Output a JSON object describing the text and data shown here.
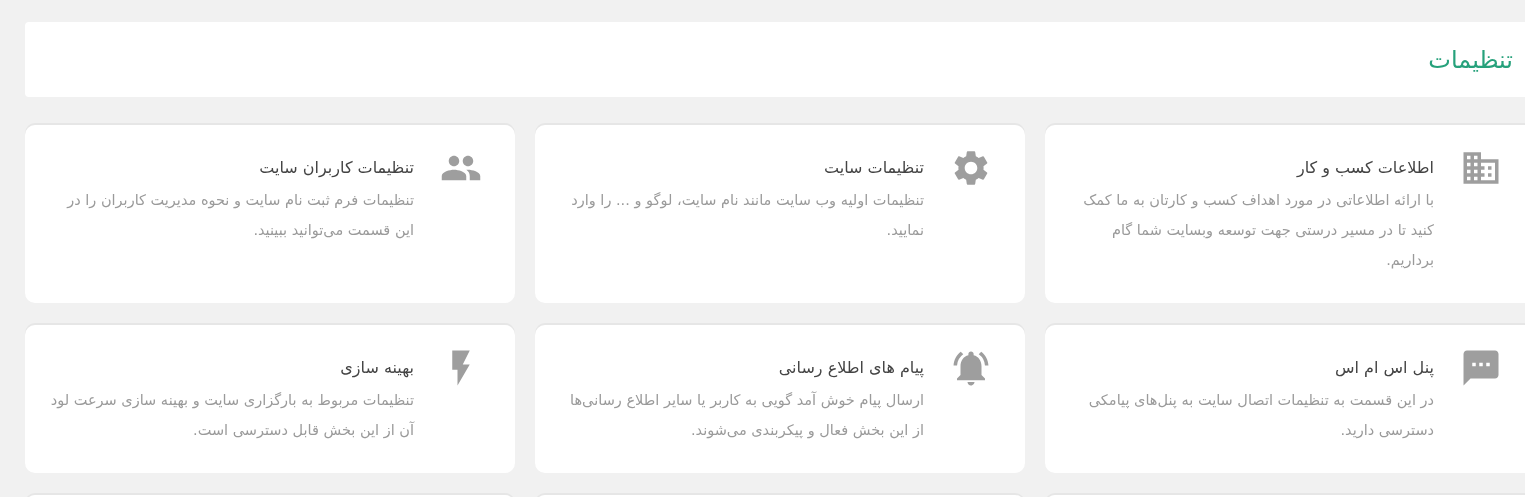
{
  "header": {
    "title": "تنظیمات"
  },
  "cards": [
    {
      "kind": "feature",
      "title": "اطلاعات کسب و کار",
      "description": "با ارائه اطلاعاتی در مورد اهداف کسب و کارتان به ما کمک کنید تا در مسیر درستی جهت توسعه وبسایت شما گام برداریم."
    },
    {
      "kind": "feature",
      "title": "تنظیمات سایت",
      "description": "تنظیمات اولیه وب سایت مانند نام سایت، لوگو و ... را وارد نمایید."
    },
    {
      "kind": "feature",
      "title": "تنظیمات کاربران سایت",
      "description": "تنظیمات فرم ثبت نام سایت و نحوه مدیریت کاربران را در این قسمت می‌توانید ببینید."
    },
    {
      "kind": "feature",
      "title": "پنل اس ام اس",
      "description": "در این قسمت به تنظیمات اتصال سایت به پنل‌های پیامکی دسترسی دارید."
    },
    {
      "kind": "feature",
      "title": "پیام های اطلاع رسانی",
      "description": "ارسال پیام خوش آمد گویی به کاربر یا سایر اطلاع رسانی‌ها از این بخش فعال و پیکربندی می‌شوند."
    },
    {
      "kind": "feature",
      "title": "بهینه سازی",
      "description": "تنظیمات مربوط به بارگزاری سایت و بهینه سازی سرعت لود آن از این بخش قابل دسترسی است."
    },
    {
      "kind": "cut"
    },
    {
      "kind": "cut"
    },
    {
      "kind": "cut"
    }
  ]
}
